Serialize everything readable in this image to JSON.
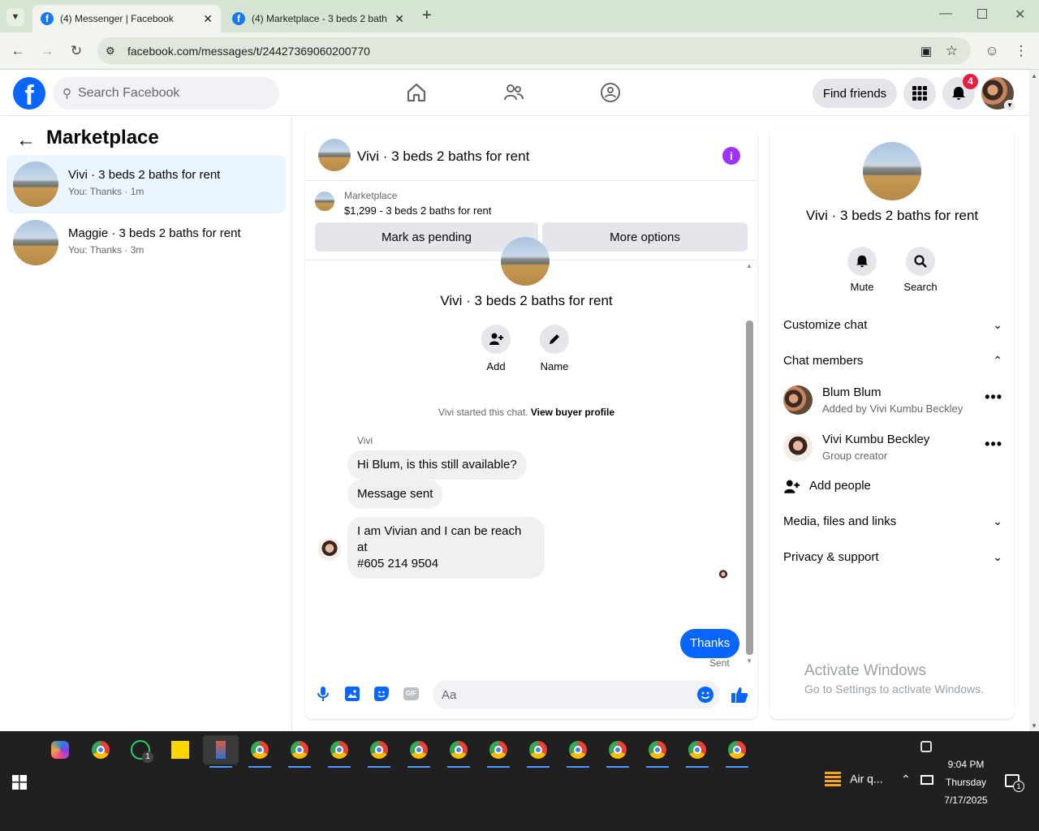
{
  "browser": {
    "tabs": [
      {
        "title": "(4) Messenger | Facebook",
        "active": true
      },
      {
        "title": "(4) Marketplace - 3 beds 2 bath",
        "active": false
      }
    ],
    "url": "facebook.com/messages/t/24427369060200770"
  },
  "fb_header": {
    "search_placeholder": "Search Facebook",
    "find_friends": "Find friends",
    "notification_count": "4"
  },
  "left": {
    "title": "Marketplace",
    "conversations": [
      {
        "title": "Vivi · 3 beds 2 baths for rent",
        "subtitle": "You: Thanks · 1m"
      },
      {
        "title": "Maggie · 3 beds 2 baths for rent",
        "subtitle": "You: Thanks · 3m"
      }
    ]
  },
  "chat": {
    "header_title": "Vivi · 3 beds 2 baths for rent",
    "listing_source": "Marketplace",
    "listing_text": "$1,299 - 3 beds 2 baths for rent",
    "mark_pending": "Mark as pending",
    "more_options": "More options",
    "group_name": "Vivi · 3 beds 2 baths for rent",
    "add_label": "Add",
    "name_label": "Name",
    "started_text": "Vivi started this chat.",
    "view_buyer": "View buyer profile",
    "sender_name": "Vivi",
    "messages": [
      {
        "text": "Hi Blum, is this still available?"
      },
      {
        "text": "Message sent"
      },
      {
        "text_line1": "I am Vivian and I can be reach at",
        "text_line2": "#605 214 9504"
      }
    ],
    "my_message": "Thanks",
    "sent_status": "Sent",
    "composer_placeholder": "Aa"
  },
  "right": {
    "title": "Vivi · 3 beds 2 baths for rent",
    "mute": "Mute",
    "search": "Search",
    "customize": "Customize chat",
    "members_heading": "Chat members",
    "members": [
      {
        "name": "Blum Blum",
        "note": "Added by Vivi Kumbu Beckley"
      },
      {
        "name": "Vivi Kumbu Beckley",
        "note": "Group creator"
      }
    ],
    "add_people": "Add people",
    "media": "Media, files and links",
    "privacy": "Privacy & support",
    "activate_title": "Activate Windows",
    "activate_sub": "Go to Settings to activate Windows."
  },
  "taskbar": {
    "weather": "Air q...",
    "time": "9:04 PM",
    "day": "Thursday",
    "date": "7/17/2025",
    "whatsapp_badge": "1",
    "notif_badge": "1"
  },
  "colors": {
    "fb_blue": "#0866ff",
    "tab_bar": "#d6e5d3",
    "purple_info": "#a033ff",
    "taskbar": "#202020"
  }
}
